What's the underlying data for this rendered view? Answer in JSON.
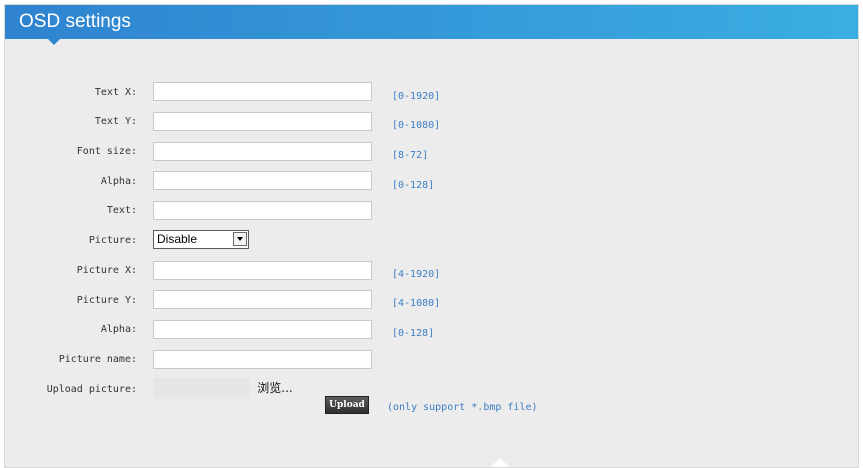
{
  "header": {
    "title": "OSD settings"
  },
  "fields": [
    {
      "label": "Text X:",
      "value": "",
      "range": "[0-1920]"
    },
    {
      "label": "Text Y:",
      "value": "",
      "range": "[0-1080]"
    },
    {
      "label": "Font size:",
      "value": "",
      "range": "[8-72]"
    },
    {
      "label": "Alpha:",
      "value": "",
      "range": "[0-128]"
    },
    {
      "label": "Text:",
      "value": ""
    },
    {
      "label": "Picture:",
      "selected": "Disable"
    },
    {
      "label": "Picture X:",
      "value": "",
      "range": "[4-1920]"
    },
    {
      "label": "Picture Y:",
      "value": "",
      "range": "[4-1080]"
    },
    {
      "label": "Alpha:",
      "value": "",
      "range": "[0-128]"
    },
    {
      "label": "Picture name:",
      "value": ""
    }
  ],
  "upload": {
    "label": "Upload picture:",
    "browse_label": "浏览...",
    "upload_label": "Upload",
    "note": "(only support *.bmp file)"
  },
  "colors": {
    "header_start": "#2f83cf",
    "header_end": "#3aaee2",
    "range_text": "#3c7ec4"
  }
}
